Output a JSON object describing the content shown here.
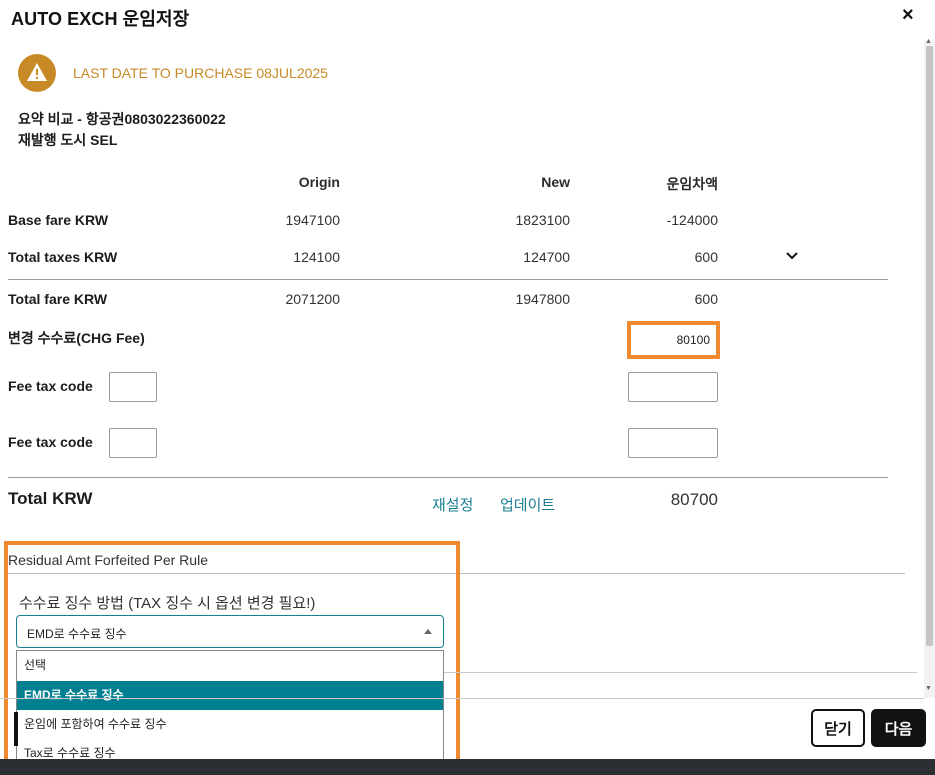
{
  "dialog": {
    "title": "AUTO EXCH 운임저장",
    "close_symbol": "×"
  },
  "warning": {
    "icon": "warning-icon",
    "text": "LAST DATE TO PURCHASE 08JUL2025",
    "color": "#c88a27"
  },
  "summary": {
    "line1": "요약 비교 - 항공권0803022360022",
    "line2": "재발행 도시 SEL"
  },
  "table": {
    "headers": [
      "Origin",
      "New",
      "운임차액"
    ],
    "rows": [
      {
        "label": "Base fare KRW",
        "values": [
          "1947100",
          "1823100",
          "-124000"
        ]
      },
      {
        "label": "Total taxes KRW",
        "values": [
          "124100",
          "124700",
          "600"
        ]
      },
      {
        "label": "Total fare KRW",
        "values": [
          "2071200",
          "1947800",
          "600"
        ]
      }
    ],
    "expand_icon": "chevron-down-icon"
  },
  "fees": {
    "chg_label": "변경 수수료(CHG Fee)",
    "chg_value": "80100",
    "fee_tax_rows": [
      {
        "label": "Fee tax code",
        "code": "",
        "amount": ""
      },
      {
        "label": "Fee tax code",
        "code": "",
        "amount": ""
      }
    ]
  },
  "total": {
    "label": "Total KRW",
    "reset_link": "재설정",
    "update_link": "업데이트",
    "value": "80700"
  },
  "residual": {
    "label": "Residual Amt Forfeited Per Rule",
    "collect_label": "수수료 징수 방법 (TAX 징수 시 옵션 변경 필요!)",
    "selected": "EMD로 수수료 징수",
    "options": [
      "선택",
      "EMD로 수수료 징수",
      "운임에 포함하여 수수료 징수",
      "Tax로 수수료 징수"
    ],
    "selected_index": 1
  },
  "footer": {
    "close_button": "닫기",
    "next_button": "다음"
  },
  "colors": {
    "accent": "#1b7f94",
    "selected_option": "#007f90",
    "highlight": "#f08a2e",
    "warning": "#c88a27"
  }
}
